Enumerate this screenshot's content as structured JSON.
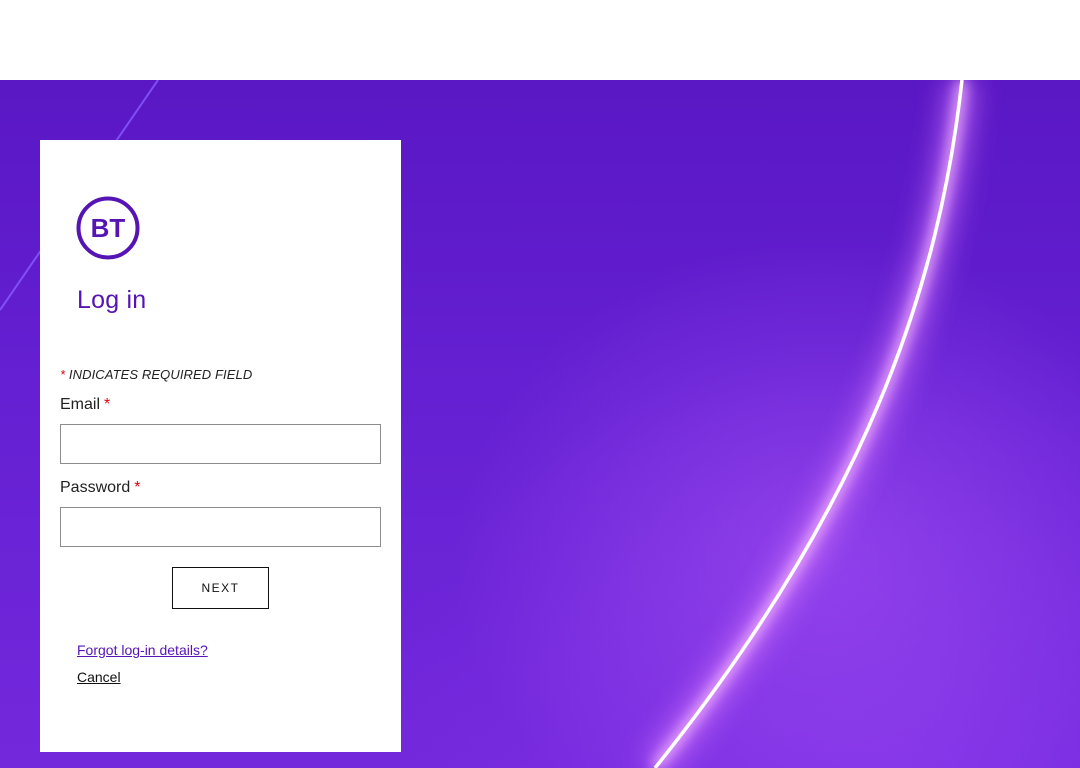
{
  "brand": {
    "logo_text": "BT",
    "purple": "#5514b4"
  },
  "login": {
    "title": "Log in",
    "required_star": "*",
    "required_note": " INDICATES REQUIRED FIELD",
    "email_label": "Email",
    "email_value": "",
    "password_label": "Password",
    "password_value": "",
    "next_label": "NEXT",
    "forgot_link": "Forgot log-in details?",
    "cancel_link": "Cancel"
  }
}
